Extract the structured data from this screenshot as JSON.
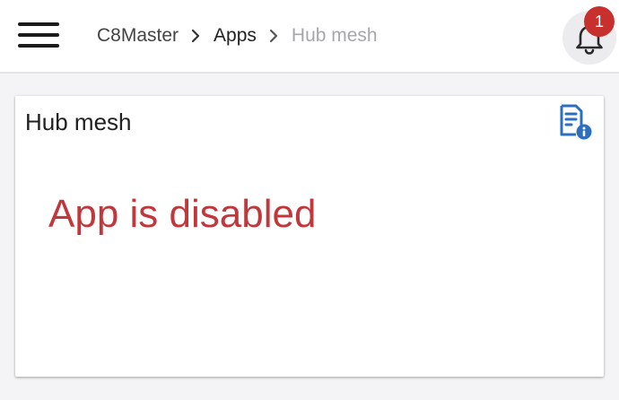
{
  "header": {
    "breadcrumb": {
      "root": "C8Master",
      "parent": "Apps",
      "current": "Hub mesh"
    },
    "notifications": {
      "count": "1"
    }
  },
  "card": {
    "title": "Hub mesh",
    "message": "App is disabled"
  },
  "icons": {
    "menu": "hamburger-menu-icon",
    "separator": "chevron-right-icon",
    "notifications": "bell-icon",
    "info": "document-info-icon"
  },
  "colors": {
    "accent": "#2d6fbf",
    "error": "#c0383c",
    "badge": "#c8302e"
  }
}
